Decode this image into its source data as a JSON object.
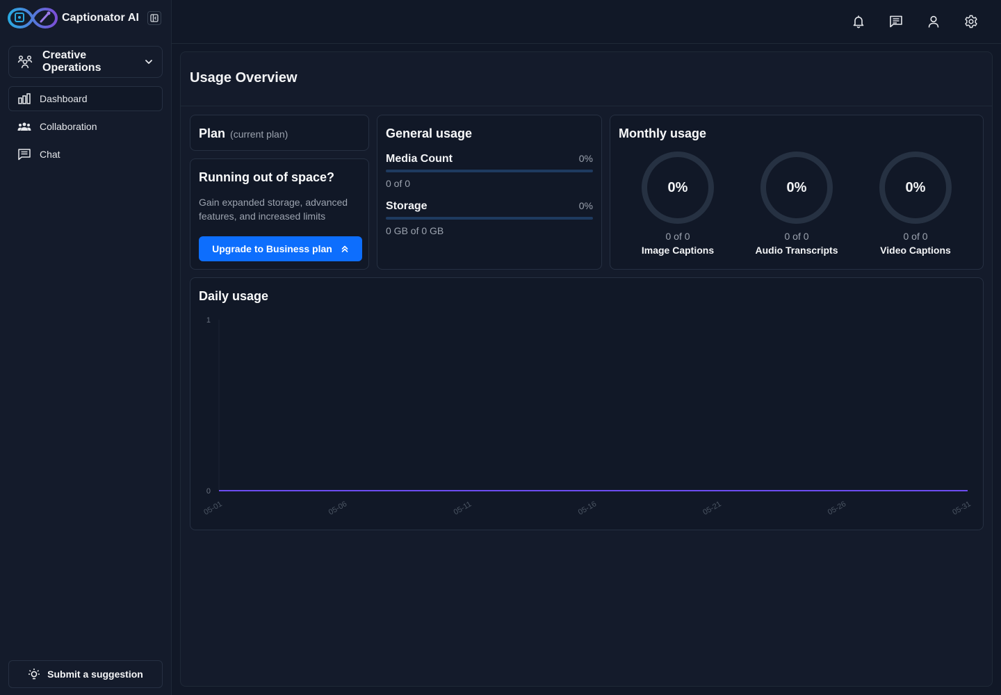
{
  "app": {
    "name": "Captionator AI"
  },
  "workspace": {
    "name": "Creative Operations"
  },
  "sidebar": {
    "items": [
      {
        "label": "Dashboard",
        "icon": "bar-chart-icon",
        "active": true
      },
      {
        "label": "Collaboration",
        "icon": "team-icon",
        "active": false
      },
      {
        "label": "Chat",
        "icon": "chat-icon",
        "active": false
      }
    ],
    "suggestion_label": "Submit a suggestion"
  },
  "topbar": {
    "icons": [
      "bell-icon",
      "messages-icon",
      "user-icon",
      "settings-icon"
    ]
  },
  "page": {
    "title": "Usage Overview"
  },
  "plan": {
    "title": "Plan",
    "subtitle": "(current plan)"
  },
  "promo": {
    "title": "Running out of space?",
    "text": "Gain expanded storage, advanced features, and increased limits",
    "button_label": "Upgrade to Business plan"
  },
  "general_usage": {
    "title": "General usage",
    "rows": [
      {
        "label": "Media Count",
        "percent": "0%",
        "value": 0,
        "detail": "0 of 0"
      },
      {
        "label": "Storage",
        "percent": "0%",
        "value": 0,
        "detail": "0 GB of 0 GB"
      }
    ]
  },
  "monthly_usage": {
    "title": "Monthly usage",
    "items": [
      {
        "percent": "0%",
        "value": 0,
        "detail": "0 of 0",
        "label": "Image Captions"
      },
      {
        "percent": "0%",
        "value": 0,
        "detail": "0 of 0",
        "label": "Audio Transcripts"
      },
      {
        "percent": "0%",
        "value": 0,
        "detail": "0 of 0",
        "label": "Video Captions"
      }
    ]
  },
  "daily_usage": {
    "title": "Daily usage"
  },
  "colors": {
    "accent": "#0d6efd",
    "line": "#6d4df2",
    "background": "#111827",
    "panel": "#141b2b",
    "ring_track": "#263142"
  },
  "chart_data": {
    "type": "line",
    "title": "Daily usage",
    "x": [
      "05-01",
      "05-02",
      "05-03",
      "05-04",
      "05-05",
      "05-06",
      "05-07",
      "05-08",
      "05-09",
      "05-10",
      "05-11",
      "05-12",
      "05-13",
      "05-14",
      "05-15",
      "05-16",
      "05-17",
      "05-18",
      "05-19",
      "05-20",
      "05-21",
      "05-22",
      "05-23",
      "05-24",
      "05-25",
      "05-26",
      "05-27",
      "05-28",
      "05-29",
      "05-30",
      "05-31"
    ],
    "xticks": [
      "05-01",
      "05-06",
      "05-11",
      "05-16",
      "05-21",
      "05-26",
      "05-31"
    ],
    "series": [
      {
        "values": [
          0,
          0,
          0,
          0,
          0,
          0,
          0,
          0,
          0,
          0,
          0,
          0,
          0,
          0,
          0,
          0,
          0,
          0,
          0,
          0,
          0,
          0,
          0,
          0,
          0,
          0,
          0,
          0,
          0,
          0,
          0
        ]
      }
    ],
    "yticks": [
      "0",
      "1"
    ],
    "ylim": [
      0,
      1
    ],
    "grid": false
  }
}
